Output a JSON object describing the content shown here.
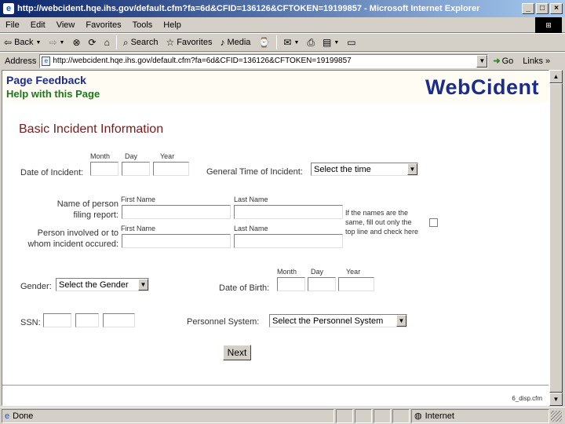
{
  "window": {
    "title": "http://webcident.hqe.ihs.gov/default.cfm?fa=6d&CFID=136126&CFTOKEN=19199857 - Microsoft Internet Explorer",
    "minimize": "_",
    "maximize": "□",
    "close": "×"
  },
  "menu": [
    {
      "label": "File"
    },
    {
      "label": "Edit"
    },
    {
      "label": "View"
    },
    {
      "label": "Favorites"
    },
    {
      "label": "Tools"
    },
    {
      "label": "Help"
    }
  ],
  "toolbar": {
    "back": "Back",
    "search": "Search",
    "favorites": "Favorites",
    "media": "Media"
  },
  "address": {
    "label": "Address",
    "url": "http://webcident.hqe.ihs.gov/default.cfm?fa=6d&CFID=136126&CFTOKEN=19199857",
    "go": "Go",
    "links": "Links"
  },
  "page": {
    "page_feedback": "Page Feedback",
    "help": "Help with this Page",
    "brand": "WebCident",
    "section_title": "Basic Incident Information",
    "date_of_incident": {
      "label": "Date of Incident:",
      "month": "Month",
      "day": "Day",
      "year": "Year"
    },
    "general_time": {
      "label": "General Time of Incident:",
      "selected": "Select the time"
    },
    "reporter": {
      "label_line1": "Name of person",
      "label_line2": "filing report:",
      "first": "First Name",
      "last": "Last Name"
    },
    "involved": {
      "label_line1": "Person involved or to",
      "label_line2": "whom incident occured:",
      "first": "First Name",
      "last": "Last Name"
    },
    "same_note": {
      "line1": "If the names are the",
      "line2": "same, fill out only the",
      "line3": "top line and check here"
    },
    "gender": {
      "label": "Gender:",
      "selected": "Select the Gender"
    },
    "dob": {
      "label": "Date of Birth:",
      "month": "Month",
      "day": "Day",
      "year": "Year"
    },
    "ssn": {
      "label": "SSN:"
    },
    "personnel": {
      "label": "Personnel System:",
      "selected": "Select the Personnel System"
    },
    "next": "Next",
    "file_note": "6_disp.cfm"
  },
  "status": {
    "text": "Done",
    "zone": "Internet"
  }
}
